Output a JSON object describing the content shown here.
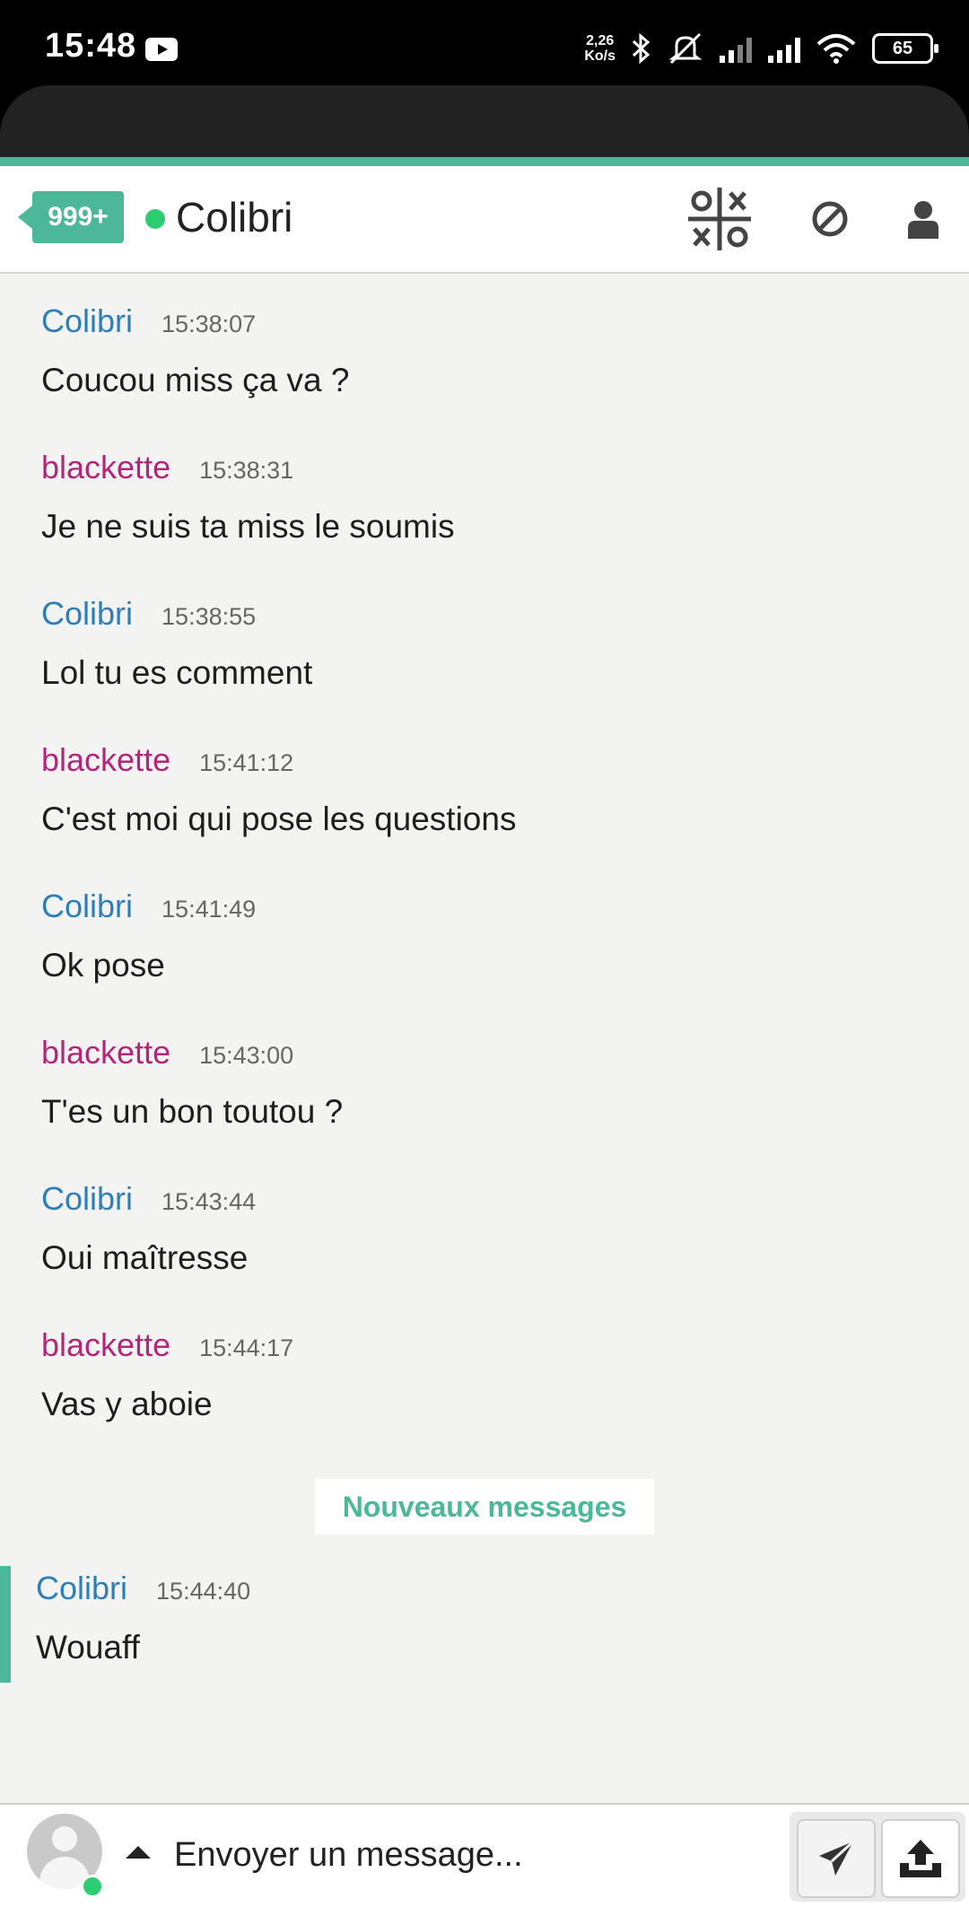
{
  "status_bar": {
    "time": "15:48",
    "net_speed_value": "2,26",
    "net_speed_unit": "Ko/s",
    "battery": "65"
  },
  "header": {
    "badge": "999+",
    "contact_name": "Colibri",
    "online": true
  },
  "messages": [
    {
      "author": "Colibri",
      "time": "15:38:07",
      "text": "Coucou miss ça va ?"
    },
    {
      "author": "blackette",
      "time": "15:38:31",
      "text": "Je ne suis ta miss le soumis"
    },
    {
      "author": "Colibri",
      "time": "15:38:55",
      "text": "Lol tu es comment"
    },
    {
      "author": "blackette",
      "time": "15:41:12",
      "text": "C'est moi qui pose les questions"
    },
    {
      "author": "Colibri",
      "time": "15:41:49",
      "text": "Ok pose"
    },
    {
      "author": "blackette",
      "time": "15:43:00",
      "text": "T'es un bon toutou ?"
    },
    {
      "author": "Colibri",
      "time": "15:43:44",
      "text": "Oui maîtresse"
    },
    {
      "author": "blackette",
      "time": "15:44:17",
      "text": "Vas y aboie"
    }
  ],
  "new_messages_divider": "Nouveaux messages",
  "new_messages": [
    {
      "author": "Colibri",
      "time": "15:44:40",
      "text": "Wouaff"
    }
  ],
  "composer": {
    "placeholder": "Envoyer un message..."
  },
  "colors": {
    "accent": "#4db899",
    "colibri": "#2e7eb8",
    "blackette": "#b3277a",
    "online": "#2ecc71"
  }
}
